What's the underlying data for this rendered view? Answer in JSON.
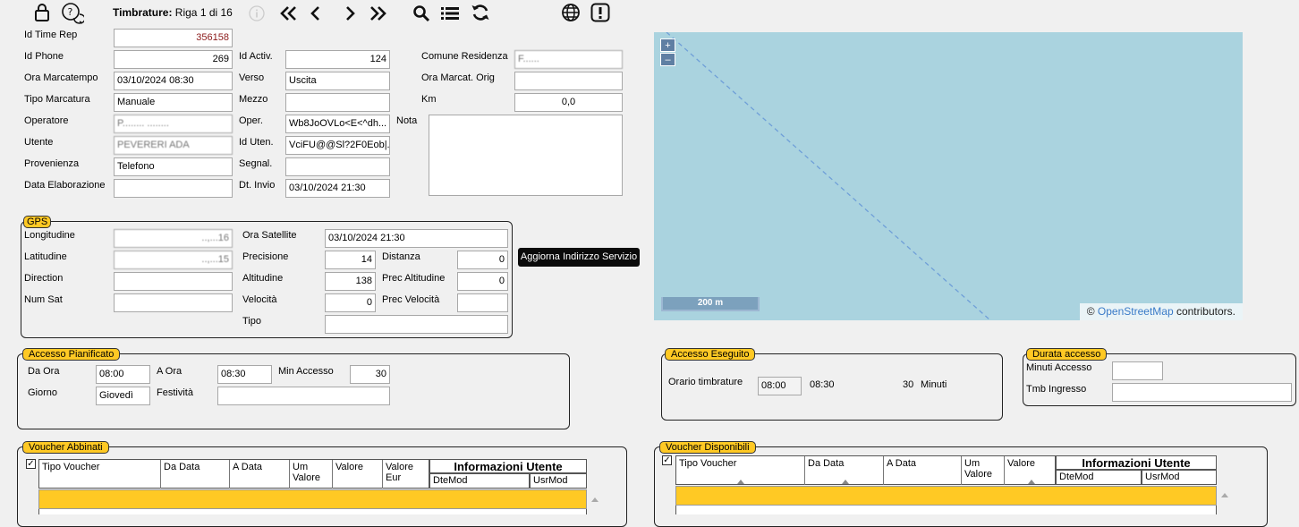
{
  "toolbar": {
    "title_bold": "Timbrature:",
    "title_rest": " Riga 1 di 16"
  },
  "main": {
    "id_time_rep": {
      "label": "Id Time Rep",
      "value": "356158"
    },
    "id_phone": {
      "label": "Id Phone",
      "value": "269"
    },
    "ora_marcatempo": {
      "label": "Ora Marcatempo",
      "value": "03/10/2024 08:30"
    },
    "tipo_marcatura": {
      "label": "Tipo Marcatura",
      "value": "Manuale"
    },
    "operatore": {
      "label": "Operatore",
      "value": "P........ ........"
    },
    "utente": {
      "label": "Utente",
      "value": "PEVERERI ADA"
    },
    "provenienza": {
      "label": "Provenienza",
      "value": "Telefono"
    },
    "data_elaborazione": {
      "label": "Data Elaborazione",
      "value": ""
    },
    "id_activ": {
      "label": "Id Activ.",
      "value": "124"
    },
    "verso": {
      "label": "Verso",
      "value": "Uscita"
    },
    "mezzo": {
      "label": "Mezzo",
      "value": ""
    },
    "oper": {
      "label": "Oper.",
      "value": "Wb8JoOVLo<E<^dh..."
    },
    "id_uten": {
      "label": "Id Uten.",
      "value": "VciFU@@Sl?2F0Eob|..."
    },
    "segnal": {
      "label": "Segnal.",
      "value": ""
    },
    "dt_invio": {
      "label": "Dt. Invio",
      "value": "03/10/2024 21:30"
    },
    "comune_residenza": {
      "label": "Comune Residenza",
      "value": "F......"
    },
    "ora_marcat_orig": {
      "label": "Ora Marcat. Orig",
      "value": ""
    },
    "km": {
      "label": "Km",
      "value": "0,0"
    },
    "nota": {
      "label": "Nota",
      "value": ""
    }
  },
  "gps": {
    "legend": "GPS",
    "longitudine": {
      "label": "Longitudine",
      "value": "..,...16"
    },
    "latitudine": {
      "label": "Latitudine",
      "value": "..,...15"
    },
    "direction": {
      "label": "Direction",
      "value": ""
    },
    "num_sat": {
      "label": "Num Sat",
      "value": ""
    },
    "ora_satellite": {
      "label": "Ora Satellite",
      "value": "03/10/2024 21:30"
    },
    "precisione": {
      "label": "Precisione",
      "value": "14"
    },
    "altitudine": {
      "label": "Altitudine",
      "value": "138"
    },
    "velocita": {
      "label": "Velocità",
      "value": "0"
    },
    "tipo": {
      "label": "Tipo",
      "value": ""
    },
    "distanza": {
      "label": "Distanza",
      "value": "0"
    },
    "prec_altitudine": {
      "label": "Prec Altitudine",
      "value": "0"
    },
    "prec_velocita": {
      "label": "Prec Velocità",
      "value": ""
    }
  },
  "tooltip": "Aggiorna Indirizzo Servizio",
  "map": {
    "zoom_in": "+",
    "zoom_out": "–",
    "scale": "200 m",
    "attr_prefix": "© ",
    "attr_link": "OpenStreetMap",
    "attr_suffix": " contributors."
  },
  "accesso_pianificato": {
    "legend": "Accesso Pianificato",
    "da_ora": {
      "label": "Da Ora",
      "value": "08:00"
    },
    "a_ora": {
      "label": "A Ora",
      "value": "08:30"
    },
    "min_accesso": {
      "label": "Min Accesso",
      "value": "30"
    },
    "giorno": {
      "label": "Giorno",
      "value": "Giovedì"
    },
    "festivita": {
      "label": "Festività",
      "value": ""
    }
  },
  "accesso_eseguito": {
    "legend": "Accesso Eseguito",
    "orario_label": "Orario timbrature",
    "start": "08:00",
    "end": "08:30",
    "minuti": "30",
    "minuti_label": "Minuti"
  },
  "durata_accesso": {
    "legend": "Durata accesso",
    "minuti_accesso": {
      "label": "Minuti Accesso",
      "value": ""
    },
    "tmb_ingresso": {
      "label": "Tmb Ingresso",
      "value": ""
    }
  },
  "voucher_abbinati": {
    "legend": "Voucher Abbinati",
    "columns": [
      "Tipo Voucher",
      "Da Data",
      "A Data",
      "Um Valore",
      "Valore",
      "Valore Eur"
    ],
    "info_title": "Informazioni Utente",
    "info_cols": [
      "DteMod",
      "UsrMod"
    ]
  },
  "voucher_disponibili": {
    "legend": "Voucher Disponibili",
    "columns": [
      "Tipo Voucher",
      "Da Data",
      "A Data",
      "Um Valore",
      "Valore"
    ],
    "info_title": "Informazioni Utente",
    "info_cols": [
      "DteMod",
      "UsrMod"
    ]
  },
  "colors": {
    "accent": "#ffc924",
    "map_water": "#aad3df"
  }
}
